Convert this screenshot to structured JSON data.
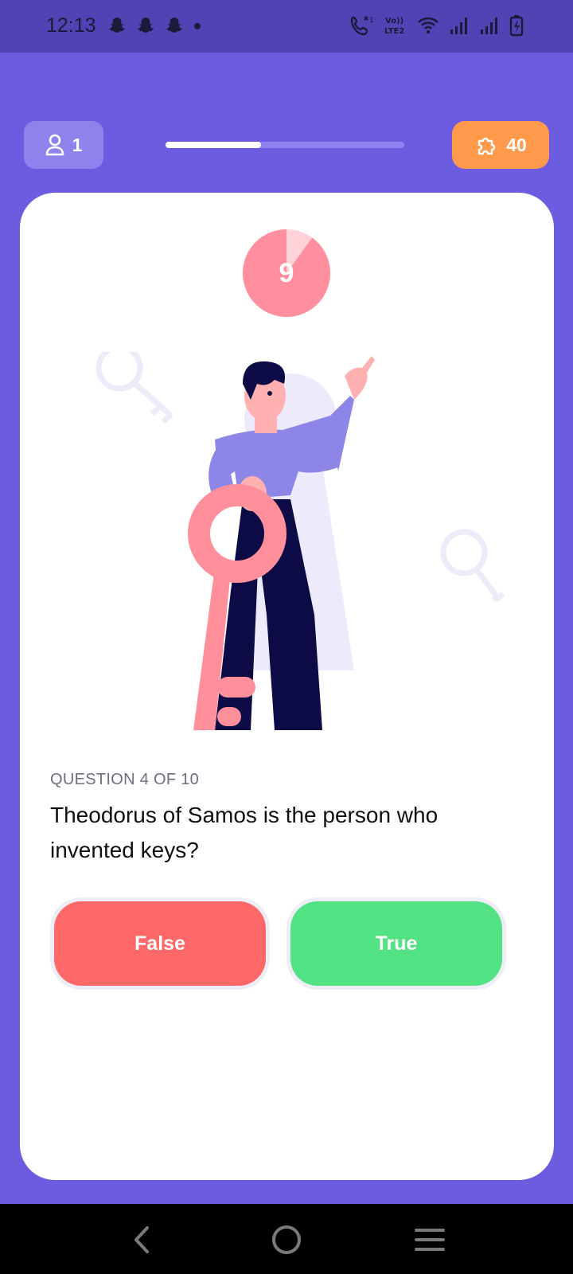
{
  "status_bar": {
    "time": "12:13",
    "notification_icons": [
      "snapchat-icon",
      "snapchat-icon",
      "snapchat-icon",
      "dot-icon"
    ],
    "right_icons": [
      "wifi-calling-icon",
      "volte-lte2-icon",
      "wifi-icon",
      "signal-icon",
      "signal-icon",
      "battery-charging-icon"
    ],
    "volte_label": "Vo)) LTE2"
  },
  "header": {
    "player_count": "1",
    "player_icon": "user-icon",
    "progress": 0.4,
    "score": "40",
    "score_icon": "puzzle-icon"
  },
  "timer": {
    "value": "9",
    "remaining_fraction": 0.9
  },
  "question": {
    "label": "QUESTION 4 OF 10",
    "text": "Theodorus of Samos is the person who invented keys?"
  },
  "answers": {
    "false_label": "False",
    "true_label": "True"
  },
  "colors": {
    "background": "#6c5ce0",
    "status_bar": "#5243b4",
    "false_button": "#ff6868",
    "true_button": "#52e183",
    "score_chip": "#ff9a4d",
    "timer": "#ff8f9f"
  },
  "nav_bar": {
    "icons": [
      "back-icon",
      "home-icon",
      "menu-icon"
    ]
  }
}
